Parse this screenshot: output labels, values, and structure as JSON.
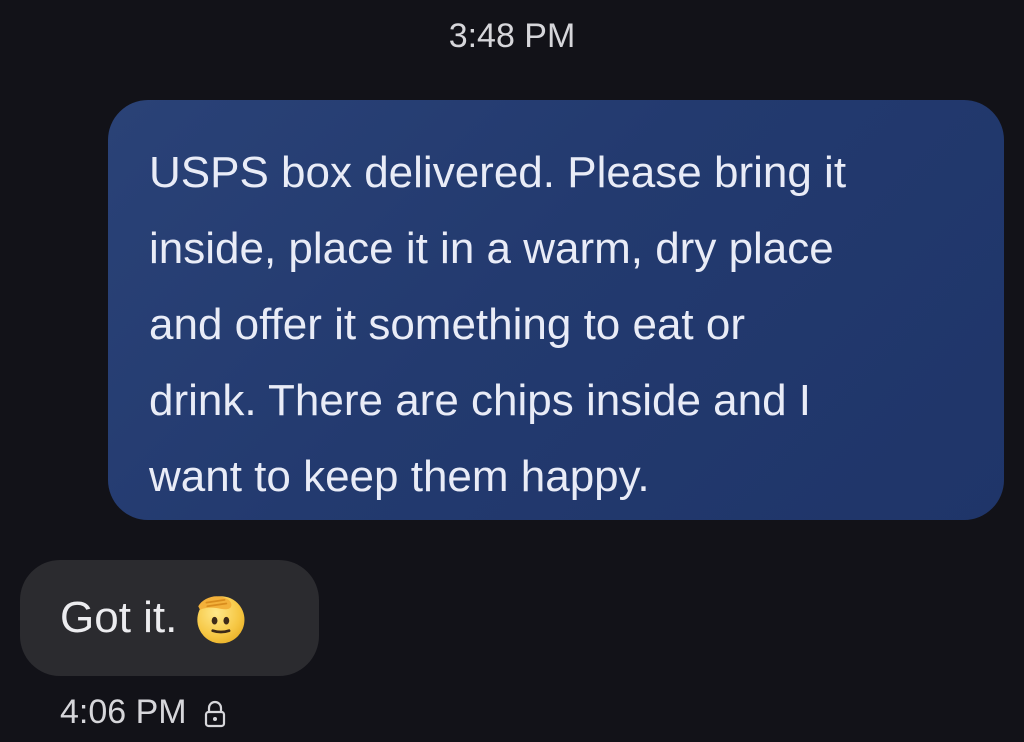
{
  "conversation": {
    "top_timestamp": "3:48 PM",
    "sent_message": {
      "text": "USPS box delivered.  Please bring it\ninside, place it in a warm, dry place\nand offer it something to eat or\ndrink.  There are chips inside and I\nwant to keep them happy."
    },
    "received_message": {
      "text": "Got it.",
      "emoji": "saluting-face-icon"
    },
    "bottom_timestamp": "4:06 PM",
    "bottom_icon": "lock-icon"
  },
  "colors": {
    "background": "#121218",
    "sent_bubble": "#233a6f",
    "received_bubble": "#2b2b2f",
    "text_primary": "#ffffff"
  }
}
